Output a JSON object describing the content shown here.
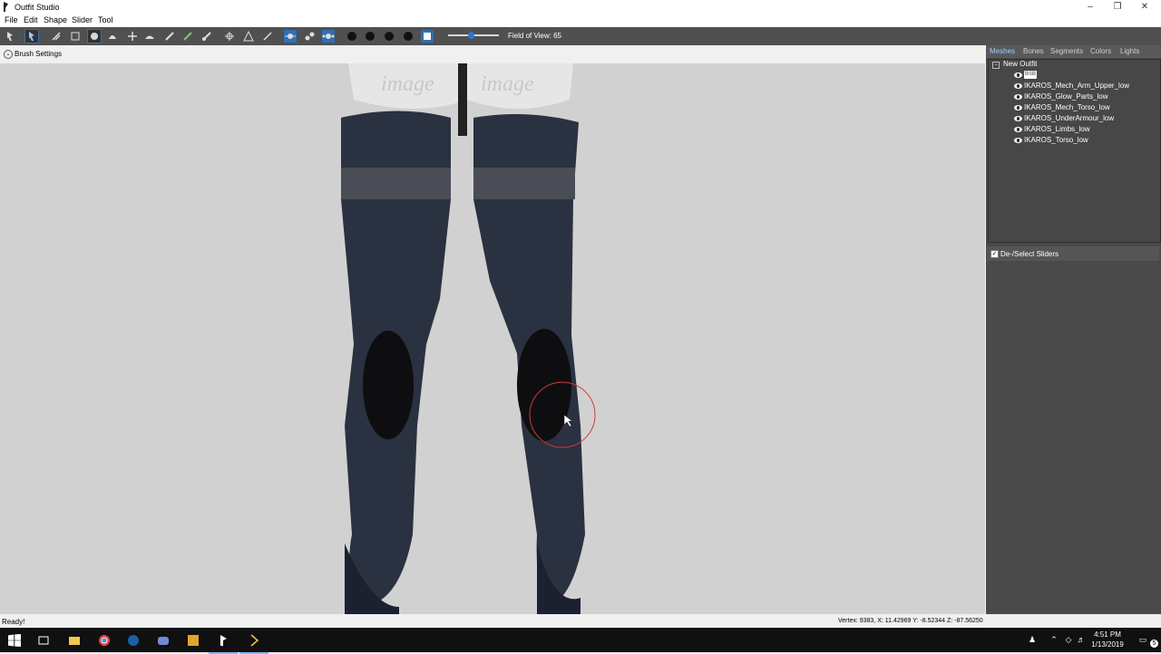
{
  "window": {
    "title": "Outfit Studio",
    "icon": "outfit-studio-icon"
  },
  "menu": [
    "File",
    "Edit",
    "Shape",
    "Slider",
    "Tool"
  ],
  "toolbar": {
    "fov_label": "Field of View: 65",
    "fov_value": 65
  },
  "brush_settings": {
    "label": "Brush Settings"
  },
  "panel": {
    "tabs": [
      "Meshes",
      "Bones",
      "Segments",
      "Colors",
      "Lights"
    ],
    "tree_root": "New Outfit",
    "selected_mesh_badge": "BSB",
    "meshes": [
      "IKAROS_Mech_Arm_Upper_low",
      "IKAROS_Glow_Parts_low",
      "IKAROS_Mech_Torso_low",
      "IKAROS_UnderArmour_low",
      "IKAROS_Limbs_low",
      "IKAROS_Torso_low"
    ],
    "sliders_label": "De-/Select Sliders",
    "sliders_checked": true
  },
  "status": {
    "left": "Ready!",
    "right": "Vertex: 9383, X: 11.42969 Y: -8.52344 Z: -87.56250"
  },
  "taskbar": {
    "time": "4:51 PM",
    "date": "1/13/2019",
    "notification_count": "5",
    "apps": [
      "start",
      "task-view",
      "file-explorer",
      "chrome",
      "steam",
      "discord",
      "app-yellow",
      "outfit-studio",
      "outfit-studio-2"
    ]
  },
  "colors": {
    "accent": "#2d7ad6",
    "panel_bg": "#4a4a4a",
    "viewport_bg": "#d1d1d1",
    "toolbar_bg": "#505050"
  }
}
